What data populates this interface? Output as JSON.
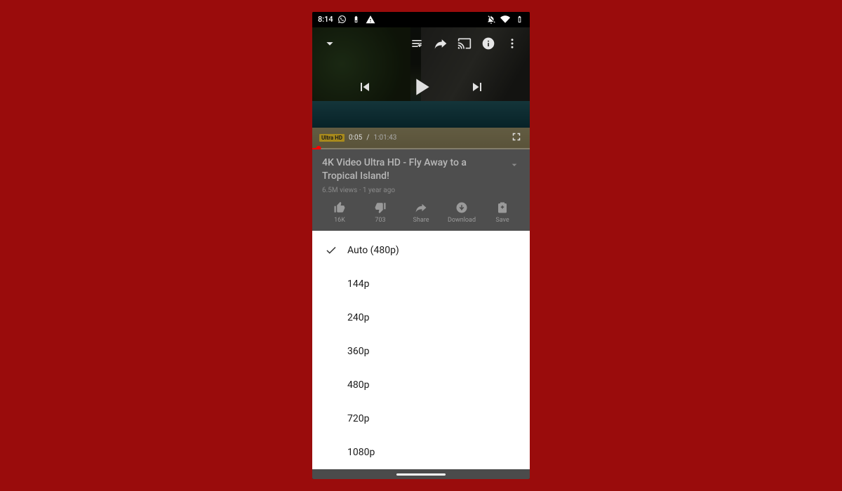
{
  "statusbar": {
    "time": "8:14"
  },
  "player": {
    "badge": "Ultra HD",
    "elapsed": "0:05",
    "sep": " / ",
    "duration": "1:01:43"
  },
  "info": {
    "title": "4K Video Ultra HD - Fly Away to a Tropical Island!",
    "meta": "6.5M views · 1 year ago"
  },
  "actions": {
    "like": "16K",
    "dislike": "703",
    "share": "Share",
    "download": "Download",
    "save": "Save"
  },
  "quality": {
    "items": [
      {
        "label": "Auto (480p)",
        "selected": true
      },
      {
        "label": "144p",
        "selected": false
      },
      {
        "label": "240p",
        "selected": false
      },
      {
        "label": "360p",
        "selected": false
      },
      {
        "label": "480p",
        "selected": false
      },
      {
        "label": "720p",
        "selected": false
      },
      {
        "label": "1080p",
        "selected": false
      }
    ]
  }
}
